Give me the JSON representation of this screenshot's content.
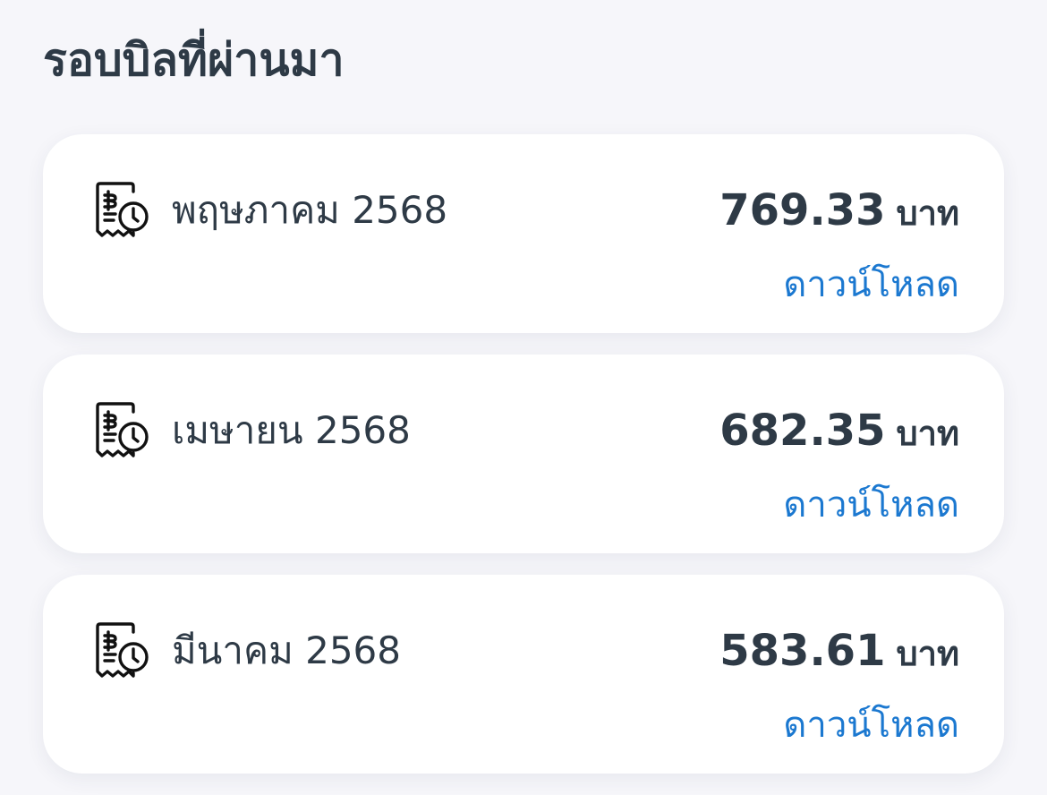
{
  "header": {
    "title": "รอบบิลที่ผ่านมา"
  },
  "bills": [
    {
      "month": "พฤษภาคม 2568",
      "amount": "769.33",
      "currency": "บาท",
      "download_label": "ดาวน์โหลด",
      "icon": "receipt-baht-clock-icon"
    },
    {
      "month": "เมษายน 2568",
      "amount": "682.35",
      "currency": "บาท",
      "download_label": "ดาวน์โหลด",
      "icon": "receipt-baht-clock-icon"
    },
    {
      "month": "มีนาคม 2568",
      "amount": "583.61",
      "currency": "บาท",
      "download_label": "ดาวน์โหลด",
      "icon": "receipt-baht-clock-icon"
    }
  ],
  "colors": {
    "background": "#f6f6fa",
    "card": "#ffffff",
    "text": "#2e3a46",
    "link": "#1b78d0"
  }
}
